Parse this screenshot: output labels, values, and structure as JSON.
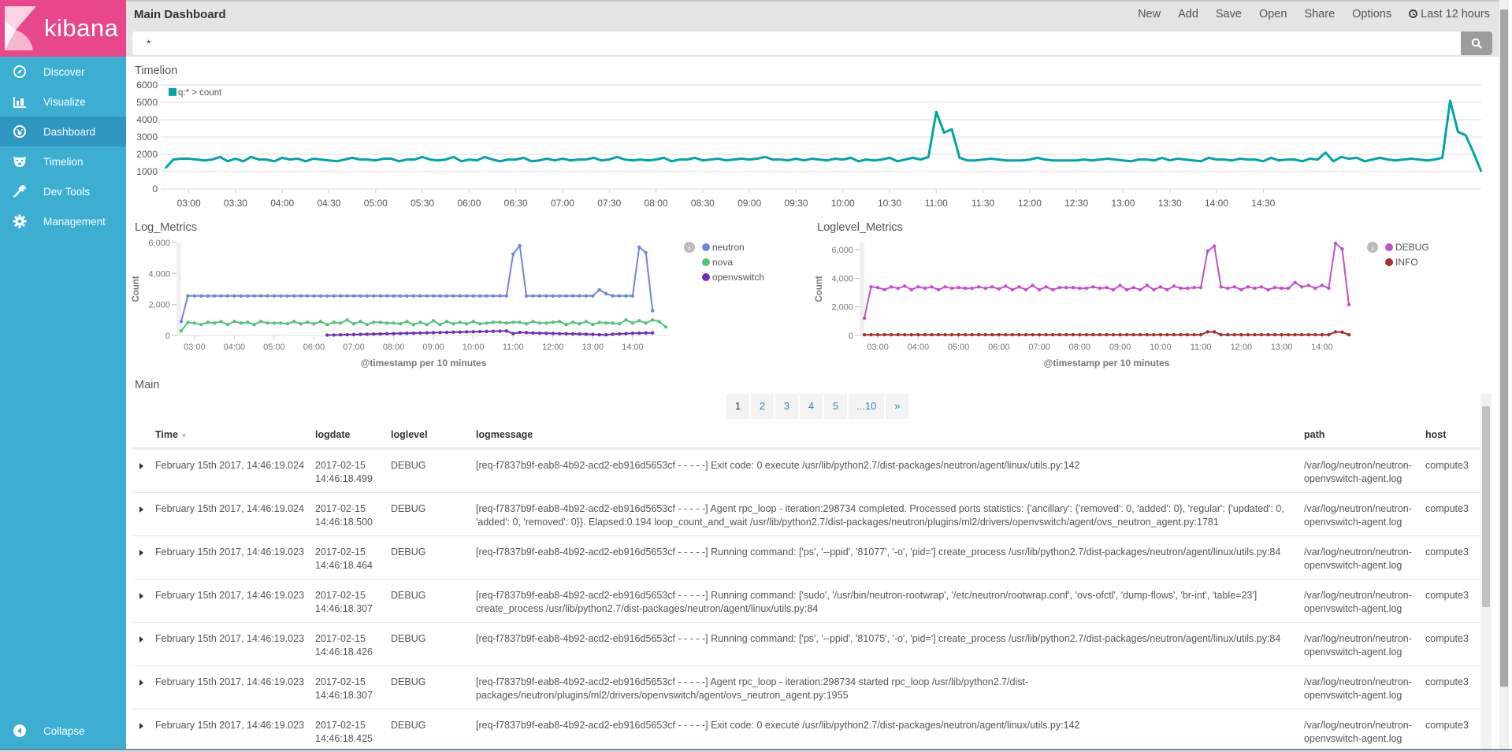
{
  "app": {
    "logo_text": "kibana",
    "brand_color": "#e8488b",
    "sidebar_color": "#3caed2",
    "sidebar_active_color": "#2e96c0"
  },
  "sidebar": {
    "items": [
      {
        "label": "Discover",
        "icon": "compass-icon"
      },
      {
        "label": "Visualize",
        "icon": "bar-chart-icon"
      },
      {
        "label": "Dashboard",
        "icon": "dashboard-gauge-icon",
        "active": true
      },
      {
        "label": "Timelion",
        "icon": "bear-icon"
      },
      {
        "label": "Dev Tools",
        "icon": "wrench-icon"
      },
      {
        "label": "Management",
        "icon": "gear-icon"
      }
    ],
    "collapse_label": "Collapse"
  },
  "header": {
    "title": "Main Dashboard",
    "menu": [
      "New",
      "Add",
      "Save",
      "Open",
      "Share",
      "Options"
    ],
    "time_range": "Last 12 hours",
    "search_value": "*"
  },
  "panels": {
    "timelion_title": "Timelion",
    "log_metrics_title": "Log_Metrics",
    "loglevel_metrics_title": "Loglevel_Metrics",
    "main_title": "Main"
  },
  "chart_data": [
    {
      "type": "line",
      "title": "Timelion",
      "legend": [
        "q:* > count"
      ],
      "legend_position": "top-left",
      "colors": [
        "#01a4a4"
      ],
      "ylim": [
        0,
        6000
      ],
      "yticks": [
        0,
        1000,
        2000,
        3000,
        4000,
        5000,
        6000
      ],
      "xticks": [
        "03:00",
        "03:30",
        "04:00",
        "04:30",
        "05:00",
        "05:30",
        "06:00",
        "06:30",
        "07:00",
        "07:30",
        "08:00",
        "08:30",
        "09:00",
        "09:30",
        "10:00",
        "10:30",
        "11:00",
        "11:30",
        "12:00",
        "12:30",
        "13:00",
        "13:30",
        "14:00",
        "14:30"
      ],
      "x_start": "02:45",
      "x_end": "14:50",
      "x_step_minutes": 5,
      "grid": true,
      "series": [
        {
          "name": "q:* > count",
          "values": [
            1200,
            1700,
            1750,
            1750,
            1700,
            1650,
            1700,
            1850,
            1600,
            1750,
            1600,
            1850,
            1700,
            1700,
            1600,
            1800,
            1700,
            1750,
            1600,
            1750,
            1700,
            1650,
            1600,
            1700,
            1800,
            1700,
            1700,
            1650,
            1750,
            1750,
            1600,
            1700,
            1700,
            1850,
            1700,
            1650,
            1700,
            1850,
            1600,
            1700,
            1650,
            1850,
            1700,
            1600,
            1700,
            1700,
            1800,
            1600,
            1650,
            1750,
            1650,
            1750,
            1650,
            1700,
            1700,
            1800,
            1650,
            1700,
            1850,
            1700,
            1650,
            1700,
            1650,
            1700,
            1800,
            1600,
            1700,
            1700,
            1800,
            1650,
            1700,
            1750,
            1650,
            1700,
            1750,
            1700,
            1750,
            1850,
            1700,
            1700,
            1650,
            1750,
            1650,
            1750,
            1700,
            1650,
            1750,
            1700,
            1800,
            1600,
            1700,
            1650,
            1700,
            1800,
            1600,
            1700,
            1800,
            1700,
            1850,
            4450,
            3250,
            3450,
            1800,
            1650,
            1650,
            1700,
            1750,
            1700,
            1650,
            1650,
            1650,
            1700,
            1800,
            1700,
            1650,
            1650,
            1650,
            1650,
            1700,
            1650,
            1700,
            1750,
            1700,
            1650,
            1600,
            1700,
            1700,
            1650,
            1800,
            1650,
            1750,
            1700,
            1650,
            1600,
            1800,
            1700,
            1700,
            1650,
            1750,
            1700,
            1700,
            1600,
            1800,
            1650,
            1700,
            1700,
            1600,
            1750,
            1700,
            2100,
            1600,
            1850,
            1750,
            1800,
            1600,
            1700,
            1800,
            1700,
            1650,
            1700,
            1750,
            1700,
            1650,
            1700,
            1800,
            5100,
            3300,
            3100,
            2100,
            1000
          ]
        }
      ]
    },
    {
      "type": "line",
      "title": "Log_Metrics",
      "xlabel": "@timestamp per 10 minutes",
      "ylabel": "Count",
      "ylim": [
        0,
        6000
      ],
      "yticks": [
        "0",
        "2,000",
        "4,000",
        "6,000"
      ],
      "xticks": [
        "03:00",
        "04:00",
        "05:00",
        "06:00",
        "07:00",
        "08:00",
        "09:00",
        "10:00",
        "11:00",
        "12:00",
        "13:00",
        "14:00"
      ],
      "legend_position": "right",
      "x_start": "02:40",
      "x_step_minutes": 10,
      "series": [
        {
          "name": "neutron",
          "color": "#6f87d8",
          "values": [
            900,
            2550,
            2550,
            2550,
            2550,
            2550,
            2550,
            2550,
            2550,
            2550,
            2550,
            2550,
            2550,
            2550,
            2550,
            2550,
            2550,
            2550,
            2550,
            2550,
            2550,
            2550,
            2550,
            2550,
            2550,
            2550,
            2550,
            2550,
            2550,
            2550,
            2550,
            2550,
            2550,
            2550,
            2550,
            2550,
            2550,
            2550,
            2550,
            2550,
            2550,
            2550,
            2550,
            2550,
            2550,
            2550,
            2550,
            2550,
            2550,
            2550,
            5250,
            5800,
            2550,
            2550,
            2550,
            2550,
            2550,
            2550,
            2550,
            2550,
            2550,
            2550,
            2550,
            2950,
            2700,
            2550,
            2550,
            2550,
            2550,
            5700,
            5350,
            1600
          ]
        },
        {
          "name": "nova",
          "color": "#57c17b",
          "values": [
            300,
            850,
            800,
            700,
            850,
            800,
            900,
            700,
            900,
            800,
            850,
            700,
            900,
            800,
            800,
            800,
            750,
            900,
            750,
            850,
            750,
            900,
            700,
            850,
            800,
            1000,
            750,
            900,
            700,
            850,
            850,
            800,
            800,
            750,
            900,
            700,
            850,
            700,
            950,
            700,
            900,
            750,
            850,
            750,
            900,
            750,
            800,
            850,
            850,
            800,
            850,
            850,
            750,
            900,
            800,
            800,
            850,
            900,
            700,
            850,
            750,
            900,
            700,
            850,
            800,
            800,
            750,
            1000,
            800,
            950,
            800,
            1000,
            900,
            550
          ]
        },
        {
          "name": "openvswitch",
          "color": "#6f2fb8",
          "values": [
            null,
            null,
            null,
            null,
            null,
            null,
            null,
            null,
            null,
            null,
            null,
            null,
            null,
            null,
            null,
            null,
            null,
            null,
            null,
            null,
            null,
            null,
            20,
            30,
            40,
            50,
            60,
            70,
            80,
            90,
            100,
            110,
            120,
            130,
            140,
            150,
            160,
            170,
            180,
            190,
            200,
            210,
            220,
            230,
            240,
            250,
            260,
            270,
            280,
            290,
            120,
            200,
            180,
            160,
            150,
            140,
            130,
            120,
            110,
            100,
            90,
            80,
            70,
            50,
            40,
            80,
            100,
            120,
            140,
            150,
            160,
            170
          ]
        }
      ]
    },
    {
      "type": "line",
      "title": "Loglevel_Metrics",
      "xlabel": "@timestamp per 10 minutes",
      "ylabel": "Count",
      "ylim": [
        0,
        6500
      ],
      "yticks": [
        "0",
        "2,000",
        "4,000",
        "6,000"
      ],
      "xticks": [
        "03:00",
        "04:00",
        "05:00",
        "06:00",
        "07:00",
        "08:00",
        "09:00",
        "10:00",
        "11:00",
        "12:00",
        "13:00",
        "14:00"
      ],
      "legend_position": "right",
      "x_start": "02:40",
      "x_step_minutes": 10,
      "series": [
        {
          "name": "DEBUG",
          "color": "#c351c9",
          "values": [
            1200,
            3400,
            3350,
            3200,
            3400,
            3300,
            3450,
            3200,
            3400,
            3300,
            3400,
            3200,
            3400,
            3300,
            3350,
            3300,
            3300,
            3400,
            3300,
            3400,
            3250,
            3450,
            3200,
            3400,
            3200,
            3500,
            3200,
            3400,
            3200,
            3350,
            3350,
            3350,
            3300,
            3300,
            3400,
            3300,
            3350,
            3200,
            3500,
            3200,
            3350,
            3200,
            3500,
            3200,
            3400,
            3200,
            3450,
            3300,
            3300,
            3350,
            3350,
            5900,
            6250,
            3400,
            3300,
            3400,
            3200,
            3400,
            3300,
            3400,
            3200,
            3350,
            3300,
            3300,
            3700,
            3400,
            3500,
            3300,
            3500,
            3300,
            6450,
            6050,
            2150
          ]
        },
        {
          "name": "INFO",
          "color": "#a5322f",
          "values": [
            50,
            50,
            50,
            50,
            50,
            50,
            50,
            50,
            50,
            50,
            50,
            50,
            50,
            50,
            50,
            50,
            50,
            50,
            50,
            50,
            50,
            50,
            50,
            50,
            50,
            50,
            50,
            50,
            50,
            50,
            50,
            50,
            50,
            50,
            50,
            50,
            50,
            50,
            50,
            50,
            50,
            50,
            50,
            50,
            50,
            50,
            50,
            50,
            50,
            50,
            50,
            250,
            250,
            50,
            50,
            50,
            50,
            50,
            50,
            50,
            50,
            50,
            50,
            50,
            50,
            50,
            50,
            50,
            50,
            50,
            250,
            230,
            50
          ]
        }
      ]
    }
  ],
  "pagination": {
    "pages": [
      "1",
      "2",
      "3",
      "4",
      "5",
      "...10",
      "»"
    ],
    "current": "1"
  },
  "table": {
    "columns": [
      "Time",
      "logdate",
      "loglevel",
      "logmessage",
      "path",
      "host"
    ],
    "sort_column": "Time",
    "rows": [
      {
        "time": "February 15th 2017, 14:46:19.024",
        "logdate": "2017-02-15 14:46:18.499",
        "loglevel": "DEBUG",
        "logmessage": "[req-f7837b9f-eab8-4b92-acd2-eb916d5653cf - - - - -] Exit code: 0 execute /usr/lib/python2.7/dist-packages/neutron/agent/linux/utils.py:142",
        "path": "/var/log/neutron/neutron-openvswitch-agent.log",
        "host": "compute3"
      },
      {
        "time": "February 15th 2017, 14:46:19.024",
        "logdate": "2017-02-15 14:46:18.500",
        "loglevel": "DEBUG",
        "logmessage": "[req-f7837b9f-eab8-4b92-acd2-eb916d5653cf - - - - -] Agent rpc_loop - iteration:298734 completed. Processed ports statistics: {'ancillary': {'removed': 0, 'added': 0}, 'regular': {'updated': 0, 'added': 0, 'removed': 0}}. Elapsed:0.194 loop_count_and_wait /usr/lib/python2.7/dist-packages/neutron/plugins/ml2/drivers/openvswitch/agent/ovs_neutron_agent.py:1781",
        "path": "/var/log/neutron/neutron-openvswitch-agent.log",
        "host": "compute3"
      },
      {
        "time": "February 15th 2017, 14:46:19.023",
        "logdate": "2017-02-15 14:46:18.464",
        "loglevel": "DEBUG",
        "logmessage": "[req-f7837b9f-eab8-4b92-acd2-eb916d5653cf - - - - -] Running command: ['ps', '--ppid', '81077', '-o', 'pid='] create_process /usr/lib/python2.7/dist-packages/neutron/agent/linux/utils.py:84",
        "path": "/var/log/neutron/neutron-openvswitch-agent.log",
        "host": "compute3"
      },
      {
        "time": "February 15th 2017, 14:46:19.023",
        "logdate": "2017-02-15 14:46:18.307",
        "loglevel": "DEBUG",
        "logmessage": "[req-f7837b9f-eab8-4b92-acd2-eb916d5653cf - - - - -] Running command: ['sudo', '/usr/bin/neutron-rootwrap', '/etc/neutron/rootwrap.conf', 'ovs-ofctl', 'dump-flows', 'br-int', 'table=23'] create_process /usr/lib/python2.7/dist-packages/neutron/agent/linux/utils.py:84",
        "path": "/var/log/neutron/neutron-openvswitch-agent.log",
        "host": "compute3"
      },
      {
        "time": "February 15th 2017, 14:46:19.023",
        "logdate": "2017-02-15 14:46:18.426",
        "loglevel": "DEBUG",
        "logmessage": "[req-f7837b9f-eab8-4b92-acd2-eb916d5653cf - - - - -] Running command: ['ps', '--ppid', '81075', '-o', 'pid='] create_process /usr/lib/python2.7/dist-packages/neutron/agent/linux/utils.py:84",
        "path": "/var/log/neutron/neutron-openvswitch-agent.log",
        "host": "compute3"
      },
      {
        "time": "February 15th 2017, 14:46:19.023",
        "logdate": "2017-02-15 14:46:18.307",
        "loglevel": "DEBUG",
        "logmessage": "[req-f7837b9f-eab8-4b92-acd2-eb916d5653cf - - - - -] Agent rpc_loop - iteration:298734 started rpc_loop /usr/lib/python2.7/dist-packages/neutron/plugins/ml2/drivers/openvswitch/agent/ovs_neutron_agent.py:1955",
        "path": "/var/log/neutron/neutron-openvswitch-agent.log",
        "host": "compute3"
      },
      {
        "time": "February 15th 2017, 14:46:19.023",
        "logdate": "2017-02-15 14:46:18.425",
        "loglevel": "DEBUG",
        "logmessage": "[req-f7837b9f-eab8-4b92-acd2-eb916d5653cf - - - - -] Exit code: 0 execute /usr/lib/python2.7/dist-packages/neutron/agent/linux/utils.py:142",
        "path": "/var/log/neutron/neutron-openvswitch-agent.log",
        "host": "compute3"
      }
    ]
  }
}
